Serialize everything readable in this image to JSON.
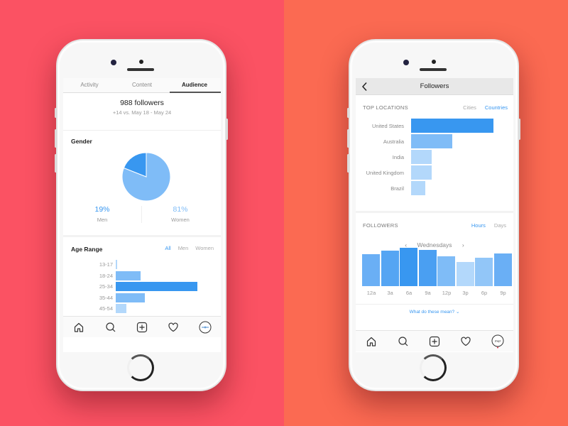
{
  "colors": {
    "background_left": "#fb5263",
    "background_right": "#fb6a52",
    "accent": "#3897f0",
    "bar_dark": "#3897f0",
    "bar_mid": "#7fbcf7",
    "bar_light": "#b3d8fb"
  },
  "left_phone": {
    "tabs": [
      {
        "label": "Activity",
        "active": false
      },
      {
        "label": "Content",
        "active": false
      },
      {
        "label": "Audience",
        "active": true
      }
    ],
    "summary": {
      "followers": "988 followers",
      "delta": "+14 vs. May 18 - May 24"
    },
    "gender": {
      "title": "Gender",
      "men": {
        "percent": "19%",
        "label": "Men",
        "value": 19
      },
      "women": {
        "percent": "81%",
        "label": "Women",
        "value": 81
      }
    },
    "age_range": {
      "title": "Age Range",
      "filters": [
        {
          "label": "All",
          "active": true
        },
        {
          "label": "Men",
          "active": false
        },
        {
          "label": "Women",
          "active": false
        }
      ],
      "rows": [
        {
          "label": "13-17",
          "value": 1
        },
        {
          "label": "18-24",
          "value": 30
        },
        {
          "label": "25-34",
          "value": 100
        },
        {
          "label": "35-44",
          "value": 36
        },
        {
          "label": "45-54",
          "value": 13
        }
      ]
    },
    "tabbar": [
      "home-icon",
      "search-icon",
      "add-post-icon",
      "activity-heart-icon",
      "profile-avatar-icon"
    ]
  },
  "right_phone": {
    "nav": {
      "title": "Followers",
      "back": "back-icon"
    },
    "top_locations": {
      "title": "TOP LOCATIONS",
      "filters": [
        {
          "label": "Cities",
          "active": false
        },
        {
          "label": "Countries",
          "active": true
        }
      ],
      "rows": [
        {
          "label": "United States",
          "value": 100
        },
        {
          "label": "Australia",
          "value": 50
        },
        {
          "label": "India",
          "value": 25
        },
        {
          "label": "United Kingdom",
          "value": 25
        },
        {
          "label": "Brazil",
          "value": 17
        }
      ]
    },
    "followers": {
      "title": "FOLLOWERS",
      "filters": [
        {
          "label": "Hours",
          "active": true
        },
        {
          "label": "Days",
          "active": false
        }
      ],
      "day": "Wednesdays",
      "hours": [
        {
          "label": "12a",
          "value": 84
        },
        {
          "label": "3a",
          "value": 92
        },
        {
          "label": "6a",
          "value": 100
        },
        {
          "label": "9a",
          "value": 94
        },
        {
          "label": "12p",
          "value": 78
        },
        {
          "label": "3p",
          "value": 63
        },
        {
          "label": "6p",
          "value": 74
        },
        {
          "label": "9p",
          "value": 85
        }
      ],
      "help_link": "What do these mean?"
    },
    "tabbar": [
      "home-icon",
      "search-icon",
      "add-post-icon",
      "activity-heart-icon",
      "profile-avatar-icon"
    ]
  }
}
